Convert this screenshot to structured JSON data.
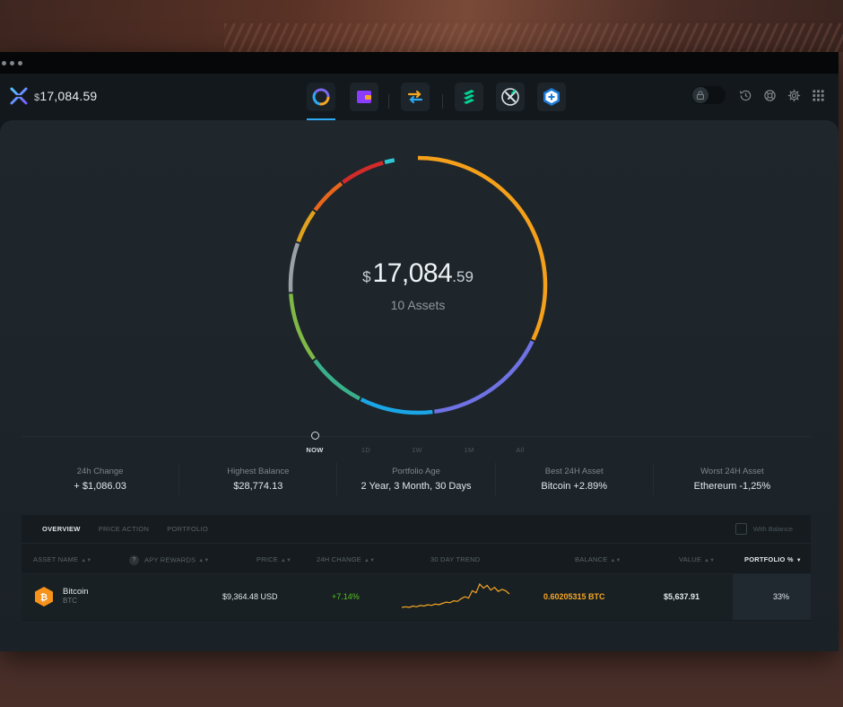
{
  "colors": {
    "accent": "#2ea8f0",
    "positive": "#52c41a",
    "bitcoin": "#f7931a",
    "balance": "#f5a623"
  },
  "header": {
    "currency_symbol": "$",
    "balance": "17,084.59"
  },
  "nav_apps": [
    {
      "name": "portfolio-icon",
      "active": true
    },
    {
      "name": "wallet-icon",
      "active": false
    },
    {
      "name": "exchange-icon",
      "active": false
    },
    {
      "name": "compound-icon",
      "active": false
    },
    {
      "name": "xrp-icon",
      "active": false
    },
    {
      "name": "add-app-icon",
      "active": false
    }
  ],
  "controls": [
    "lock-icon",
    "history-icon",
    "support-icon",
    "settings-icon",
    "grid-icon"
  ],
  "portfolio": {
    "currency_symbol": "$",
    "value_int": "17,084",
    "value_dec": ".59",
    "assets_label": "10 Assets"
  },
  "timeline": {
    "labels": [
      "NOW",
      "1D",
      "1W",
      "1M",
      "All"
    ],
    "selected": "NOW"
  },
  "stats": [
    {
      "label": "24h Change",
      "value": "+ $1,086.03"
    },
    {
      "label": "Highest Balance",
      "value": "$28,774.13"
    },
    {
      "label": "Portfolio Age",
      "value": "2 Year, 3 Month, 30 Days"
    },
    {
      "label": "Best 24H Asset",
      "value": "Bitcoin +2.89%"
    },
    {
      "label": "Worst 24H Asset",
      "value": "Ethereum -1,25%"
    }
  ],
  "table": {
    "tabs": [
      "OVERVIEW",
      "PRICE ACTION",
      "PORTFOLIO"
    ],
    "selected_tab": "OVERVIEW",
    "with_balance_label": "With Balance",
    "columns": {
      "asset_name": "ASSET NAME",
      "apy": "APY REWARDS",
      "price": "PRICE",
      "change": "24H CHANGE",
      "trend": "30 DAY TREND",
      "balance": "BALANCE",
      "value": "VALUE",
      "portfolio": "PORTFOLIO %"
    },
    "rows": [
      {
        "name": "Bitcoin",
        "symbol": "BTC",
        "price": "$9,364.48 USD",
        "change": "+7.14%",
        "balance": "0.60205315 BTC",
        "value": "$5,637.91",
        "portfolio": "33%",
        "trend": [
          20,
          21,
          20,
          22,
          21,
          23,
          22,
          24,
          23,
          25,
          24,
          26,
          28,
          27,
          30,
          29,
          33,
          36,
          34,
          45,
          42,
          55,
          49,
          53,
          46,
          50,
          44,
          47,
          45,
          40
        ]
      }
    ]
  }
}
